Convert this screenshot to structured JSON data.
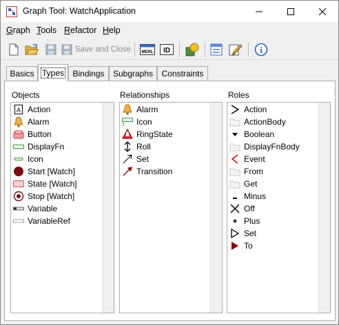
{
  "window": {
    "title": "Graph Tool: WatchApplication"
  },
  "menu": [
    {
      "pre": "",
      "key": "G",
      "post": "raph"
    },
    {
      "pre": "",
      "key": "T",
      "post": "ools"
    },
    {
      "pre": "",
      "key": "R",
      "post": "efactor"
    },
    {
      "pre": "",
      "key": "H",
      "post": "elp"
    }
  ],
  "toolbar": {
    "save_close_label": "Save and Close",
    "merl_label": "MERL",
    "id_label": "ID",
    "info_label": "i"
  },
  "tabs": [
    "Basics",
    "Types",
    "Bindings",
    "Subgraphs",
    "Constraints"
  ],
  "active_tab": "Types",
  "objects": {
    "title": "Objects",
    "items": [
      {
        "label": "Action",
        "icon": "action-icon"
      },
      {
        "label": "Alarm",
        "icon": "bell-icon"
      },
      {
        "label": "Button",
        "icon": "button-icon"
      },
      {
        "label": "DisplayFn",
        "icon": "displayfn-icon"
      },
      {
        "label": "Icon",
        "icon": "icon-shape-icon"
      },
      {
        "label": "Start [Watch]",
        "icon": "start-dot-icon"
      },
      {
        "label": "State [Watch]",
        "icon": "state-rect-icon"
      },
      {
        "label": "Stop [Watch]",
        "icon": "stop-target-icon"
      },
      {
        "label": "Variable",
        "icon": "variable-icon"
      },
      {
        "label": "VariableRef",
        "icon": "variableref-icon"
      }
    ]
  },
  "relationships": {
    "title": "Relationships",
    "items": [
      {
        "label": "Alarm",
        "icon": "bell-icon"
      },
      {
        "label": "Icon",
        "icon": "icon-shape-icon"
      },
      {
        "label": "RingState",
        "icon": "ringstate-icon"
      },
      {
        "label": "Roll",
        "icon": "roll-icon"
      },
      {
        "label": "Set",
        "icon": "set-arrow-icon"
      },
      {
        "label": "Transition",
        "icon": "transition-arrow-icon"
      }
    ]
  },
  "roles": {
    "title": "Roles",
    "items": [
      {
        "label": "Action",
        "icon": "chevron-right-icon"
      },
      {
        "label": "ActionBody",
        "icon": "folder-icon"
      },
      {
        "label": "Boolean",
        "icon": "boolean-icon"
      },
      {
        "label": "DisplayFnBody",
        "icon": "folder-icon"
      },
      {
        "label": "Event",
        "icon": "chevron-left-red-icon"
      },
      {
        "label": "From",
        "icon": "folder-icon"
      },
      {
        "label": "Get",
        "icon": "folder-icon"
      },
      {
        "label": "Minus",
        "icon": "minus-icon"
      },
      {
        "label": "Off",
        "icon": "cross-icon"
      },
      {
        "label": "Plus",
        "icon": "plus-icon"
      },
      {
        "label": "Set",
        "icon": "triangle-outline-icon"
      },
      {
        "label": "To",
        "icon": "triangle-filled-icon"
      }
    ]
  },
  "colors": {
    "accent_red": "#8b0000",
    "folder": "#f2f2f2"
  }
}
